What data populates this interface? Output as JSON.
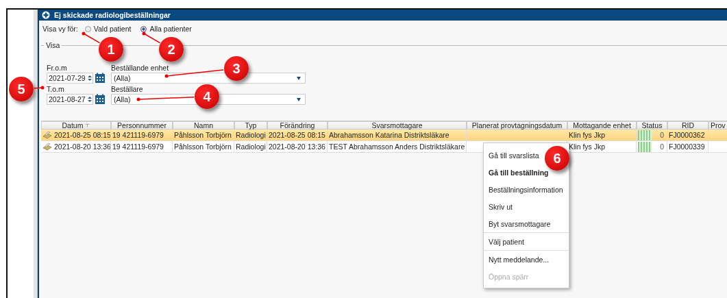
{
  "window": {
    "title": "Ej skickade radiologibeställningar"
  },
  "view_for": {
    "label": "Visa vy för:",
    "options": [
      {
        "label": "Vald patient",
        "selected": false
      },
      {
        "label": "Alla patienter",
        "selected": true
      }
    ]
  },
  "filter": {
    "legend": "Visa",
    "from": {
      "label": "Fr.o.m",
      "value": "2021-07-29"
    },
    "to": {
      "label": "T.o.m",
      "value": "2021-08-27"
    },
    "unit": {
      "label": "Beställande enhet",
      "value": "(Alla)"
    },
    "orderer": {
      "label": "Beställare",
      "value": "(Alla)"
    }
  },
  "table": {
    "columns": [
      {
        "label": "Datum",
        "sorted": true
      },
      {
        "label": "Personnummer",
        "sorted": false
      },
      {
        "label": "Namn",
        "sorted": false
      },
      {
        "label": "Typ",
        "sorted": false
      },
      {
        "label": "Förändring",
        "sorted": false
      },
      {
        "label": "Svarsmottagare",
        "sorted": false
      },
      {
        "label": "Planerat provtagningsdatum",
        "sorted": false
      },
      {
        "label": "Mottagande enhet",
        "sorted": false
      },
      {
        "label": "Status",
        "sorted": false
      },
      {
        "label": "RID",
        "sorted": false
      },
      {
        "label": "Prov"
      }
    ],
    "rows": [
      {
        "selected": true,
        "cells": [
          "2021-08-25 08:15",
          "19 421119-6979",
          "Påhlsson Torbjörn",
          "Radiologi",
          "2021-08-25 08:15",
          "Abrahamsson Katarina Distriktsläkare",
          "",
          "Klin fys Jkp",
          "0",
          "FJ0000362",
          ""
        ]
      },
      {
        "selected": false,
        "cells": [
          "2021-08-20 13:36",
          "19 421119-6979",
          "Påhlsson Torbjörn",
          "Radiologi",
          "2021-08-20 13:36",
          "TEST Abrahamsson Anders Distriktsläkare",
          "",
          "Klin fys Jkp",
          "0",
          "FJ0000339",
          ""
        ]
      }
    ]
  },
  "context_menu": {
    "groups": [
      [
        {
          "label": "Gå till svarslista",
          "default": false,
          "disabled": false
        },
        {
          "label": "Gå till beställning",
          "default": true,
          "disabled": false
        },
        {
          "label": "Beställningsinformation",
          "default": false,
          "disabled": false
        },
        {
          "label": "Skriv ut",
          "default": false,
          "disabled": false
        },
        {
          "label": "Byt svarsmottagare",
          "default": false,
          "disabled": false
        }
      ],
      [
        {
          "label": "Välj patient",
          "default": false,
          "disabled": false
        }
      ],
      [
        {
          "label": "Nytt meddelande...",
          "default": false,
          "disabled": false
        },
        {
          "label": "Öppna spärr",
          "default": false,
          "disabled": true
        }
      ]
    ]
  },
  "callouts": [
    {
      "label": "1"
    },
    {
      "label": "2"
    },
    {
      "label": "3"
    },
    {
      "label": "4"
    },
    {
      "label": "5"
    },
    {
      "label": "6"
    }
  ]
}
